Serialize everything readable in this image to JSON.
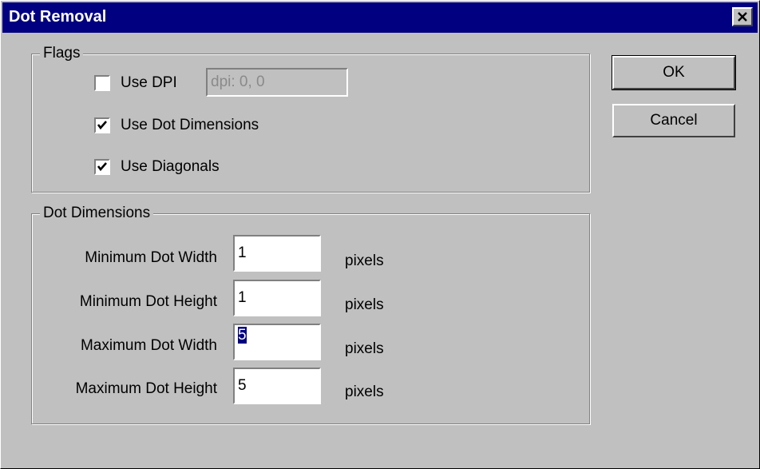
{
  "window": {
    "title": "Dot Removal"
  },
  "flags": {
    "legend": "Flags",
    "use_dpi": {
      "label": "Use DPI",
      "checked": false,
      "field_value": "dpi: 0, 0"
    },
    "use_dot_dimensions": {
      "label": "Use Dot Dimensions",
      "checked": true
    },
    "use_diagonals": {
      "label": "Use Diagonals",
      "checked": true
    }
  },
  "dot_dimensions": {
    "legend": "Dot Dimensions",
    "fields": [
      {
        "label": "Minimum Dot Width",
        "value": "1",
        "unit": "pixels"
      },
      {
        "label": "Minimum Dot Height",
        "value": "1",
        "unit": "pixels"
      },
      {
        "label": "Maximum Dot Width",
        "value": "5",
        "unit": "pixels"
      },
      {
        "label": "Maximum Dot Height",
        "value": "5",
        "unit": "pixels"
      }
    ]
  },
  "buttons": {
    "ok": "OK",
    "cancel": "Cancel"
  },
  "icons": {
    "close": "close-icon",
    "check": "checkmark-icon"
  }
}
